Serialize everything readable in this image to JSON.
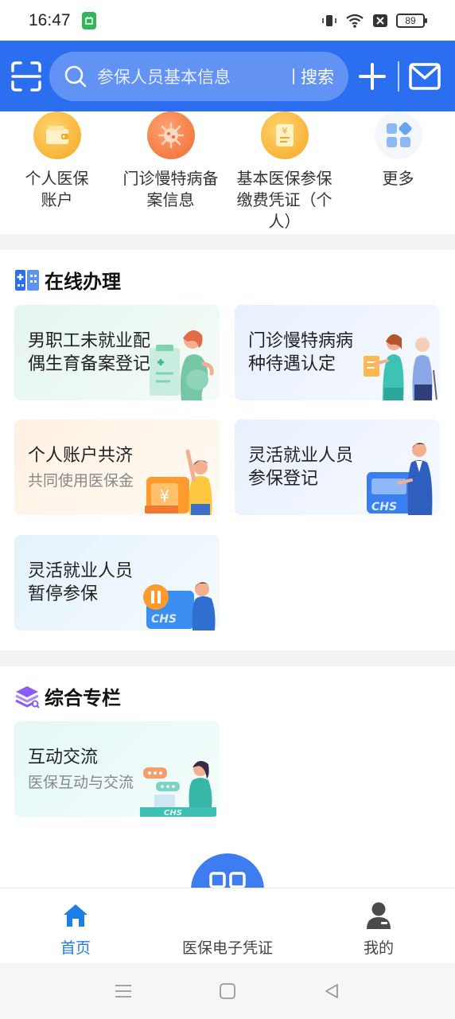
{
  "status_bar": {
    "time": "16:47",
    "battery": "89"
  },
  "header": {
    "search_placeholder": "参保人员基本信息",
    "search_button": "搜索"
  },
  "quick_links": [
    {
      "label": "个人医保账户",
      "icon": "wallet-icon"
    },
    {
      "label": "门诊慢特病备案信息",
      "icon": "virus-icon"
    },
    {
      "label": "基本医保参保缴费凭证（个人）",
      "icon": "receipt-icon"
    },
    {
      "label": "更多",
      "icon": "grid-icon"
    }
  ],
  "online_section": {
    "title": "在线办理",
    "cards": [
      {
        "title": "男职工未就业配偶生育备案登记",
        "subtitle": ""
      },
      {
        "title": "门诊慢特病病种待遇认定",
        "subtitle": ""
      },
      {
        "title": "个人账户共济",
        "subtitle": "共同使用医保金"
      },
      {
        "title": "灵活就业人员参保登记",
        "subtitle": ""
      },
      {
        "title": "灵活就业人员暂停参保",
        "subtitle": ""
      }
    ]
  },
  "column_section": {
    "title": "综合专栏",
    "cards": [
      {
        "title": "互动交流",
        "subtitle": "医保互动与交流"
      }
    ]
  },
  "bottom_nav": {
    "home": "首页",
    "voucher": "医保电子凭证",
    "mine": "我的"
  },
  "colors": {
    "brand_blue": "#2c6ef0",
    "active_nav": "#1e7ee8",
    "orange": "#f5a623"
  }
}
